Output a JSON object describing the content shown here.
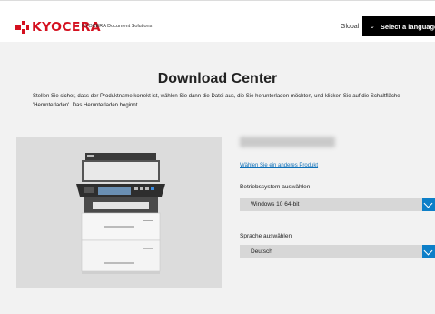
{
  "header": {
    "logo_text": "KYOCERA",
    "brand_sub": "KYOCERA Document Solutions",
    "global_label": "Global",
    "language_button": "Select a language",
    "brand_color": "#d4101f"
  },
  "main": {
    "title": "Download Center",
    "intro": "Stellen Sie sicher, dass der Produktname korrekt ist, wählen Sie dann die Datei aus, die Sie herunterladen möchten, und klicken Sie auf die Schaltfläche 'Herunterladen'. Das Herunterladen beginnt.",
    "change_product_link": "Wählen Sie ein anderes Produkt",
    "os_label": "Betriebssystem auswählen",
    "os_selected": "Windows 10 64-bit",
    "language_label": "Sprache auswählen",
    "language_selected": "Deutsch",
    "accent_color": "#0d7fc8"
  }
}
